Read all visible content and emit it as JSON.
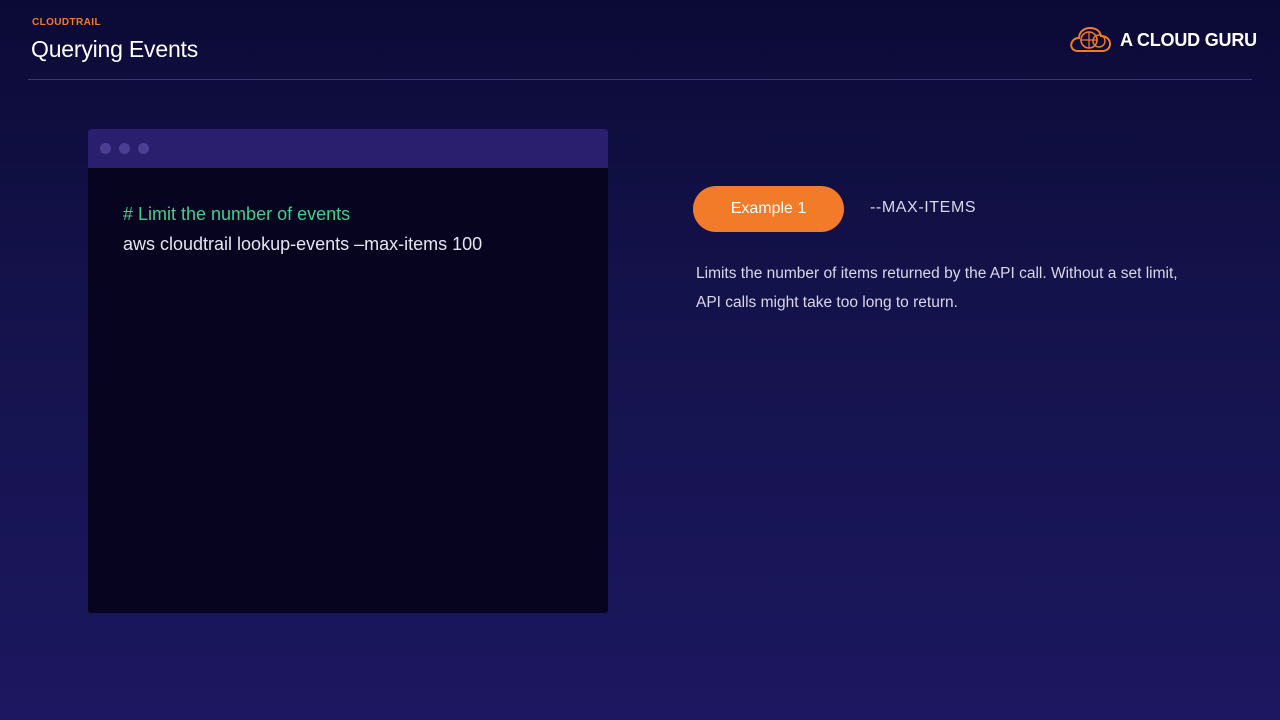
{
  "header": {
    "section": "CLOUDTRAIL",
    "title": "Querying Events",
    "logo": {
      "text": "A CLOUD GURU",
      "icon": "cloud-logo-icon"
    }
  },
  "terminal": {
    "comment": "# Limit the number of events",
    "command": "aws cloudtrail lookup-events –max-items 100"
  },
  "example": {
    "label": "Example 1",
    "flag": "--MAX-ITEMS",
    "description": "Limits the number of items returned by the API call. Without a set limit, API calls might take too long to return."
  },
  "colors": {
    "accent": "#f27b29",
    "background": "#14124a",
    "terminal": "#07041f",
    "comment": "#3fd08c"
  }
}
